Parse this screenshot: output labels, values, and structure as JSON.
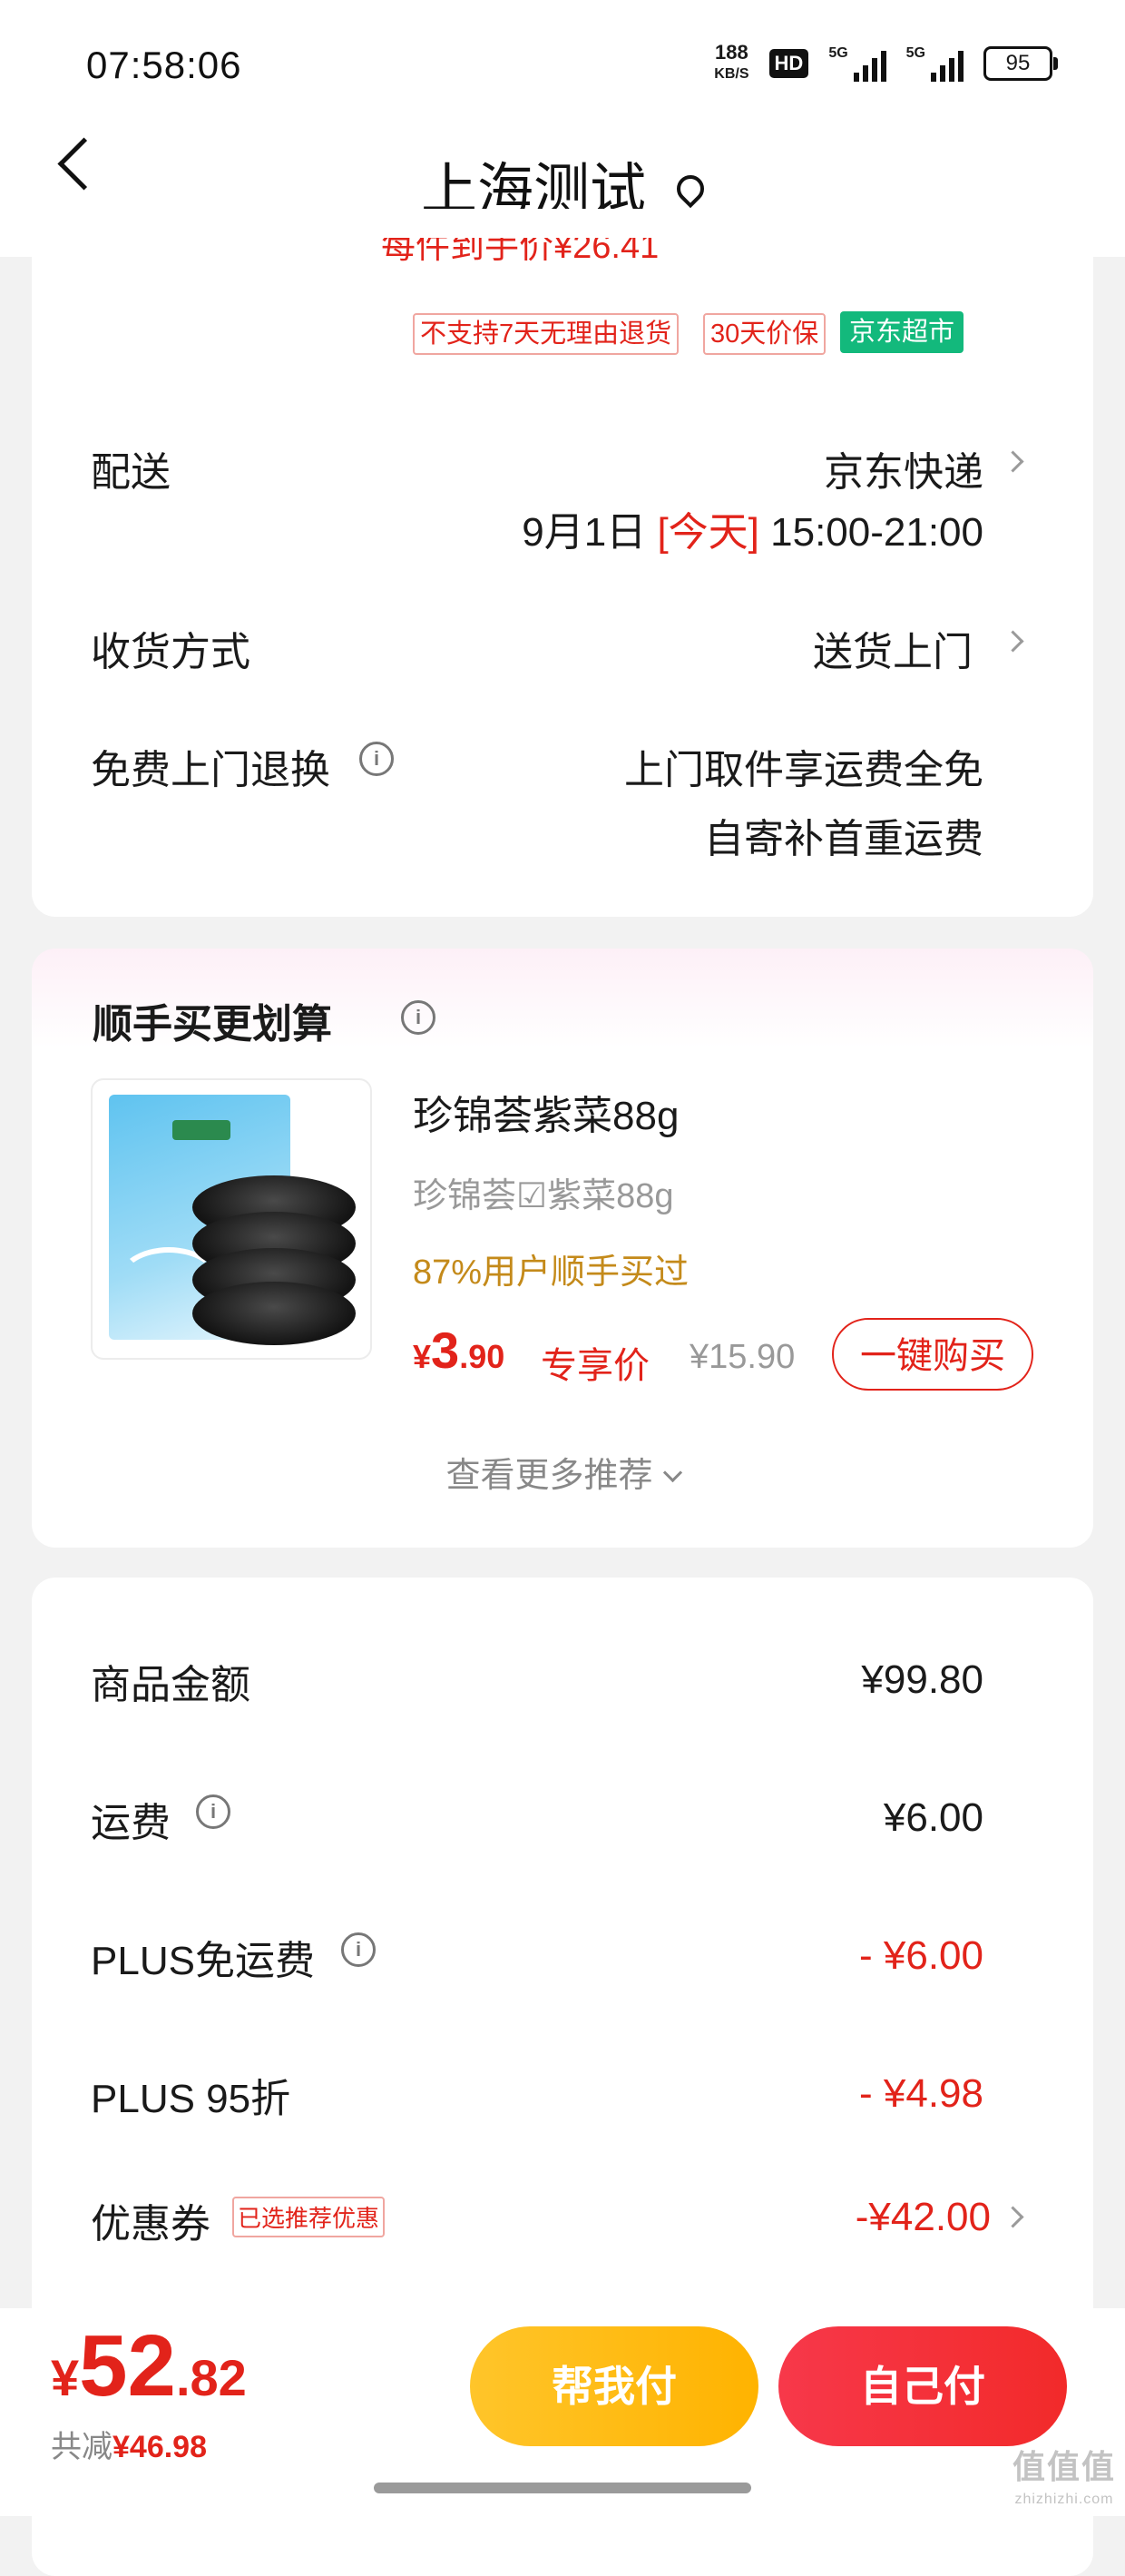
{
  "status_bar": {
    "time": "07:58:06",
    "net_speed_value": "188",
    "net_speed_unit": "KB/S",
    "hd": "HD",
    "sig1": "5G",
    "sig2": "5G",
    "battery": "95"
  },
  "header": {
    "title": "上海测试"
  },
  "price_summary": {
    "cut_text": "每件到手价¥26.41"
  },
  "tags": [
    "不支持7天无理由退货",
    "30天价保",
    "京东超市"
  ],
  "delivery": {
    "label": "配送",
    "carrier": "京东快递",
    "date": "9月1日",
    "today": "[今天]",
    "window": "15:00-21:00"
  },
  "receive": {
    "label": "收货方式",
    "value": "送货上门"
  },
  "return": {
    "label": "免费上门退换",
    "line1": "上门取件享运费全免",
    "line2": "自寄补首重运费"
  },
  "recommend": {
    "title": "顺手买更划算",
    "product": {
      "name": "珍锦荟紫菜88g",
      "spec": "珍锦荟☑紫菜88g",
      "buyers": "87%用户顺手买过",
      "price_yen": "¥",
      "price_int": "3",
      "price_dec": ".90",
      "special_label": "专享价",
      "orig_price": "¥15.90",
      "buy_label": "一键购买"
    },
    "more": "查看更多推荐"
  },
  "fees": [
    {
      "label": "商品金额",
      "value": "¥99.80",
      "red": false
    },
    {
      "label": "运费",
      "value": "¥6.00",
      "red": false
    },
    {
      "label": "PLUS免运费",
      "value": "- ¥6.00",
      "red": true
    },
    {
      "label": "PLUS 95折",
      "value": "- ¥4.98",
      "red": true
    },
    {
      "label": "优惠券",
      "value": "-¥42.00",
      "red": true,
      "tag": "已选推荐优惠"
    }
  ],
  "footer": {
    "total_yen": "¥",
    "total_int": "52",
    "total_dec": ".82",
    "saved_label": "共减",
    "saved_value": "¥46.98",
    "help_pay": "帮我付",
    "self_pay": "自己付"
  },
  "watermark": {
    "text": "值值值",
    "sub": "zhizhizhi.com"
  }
}
